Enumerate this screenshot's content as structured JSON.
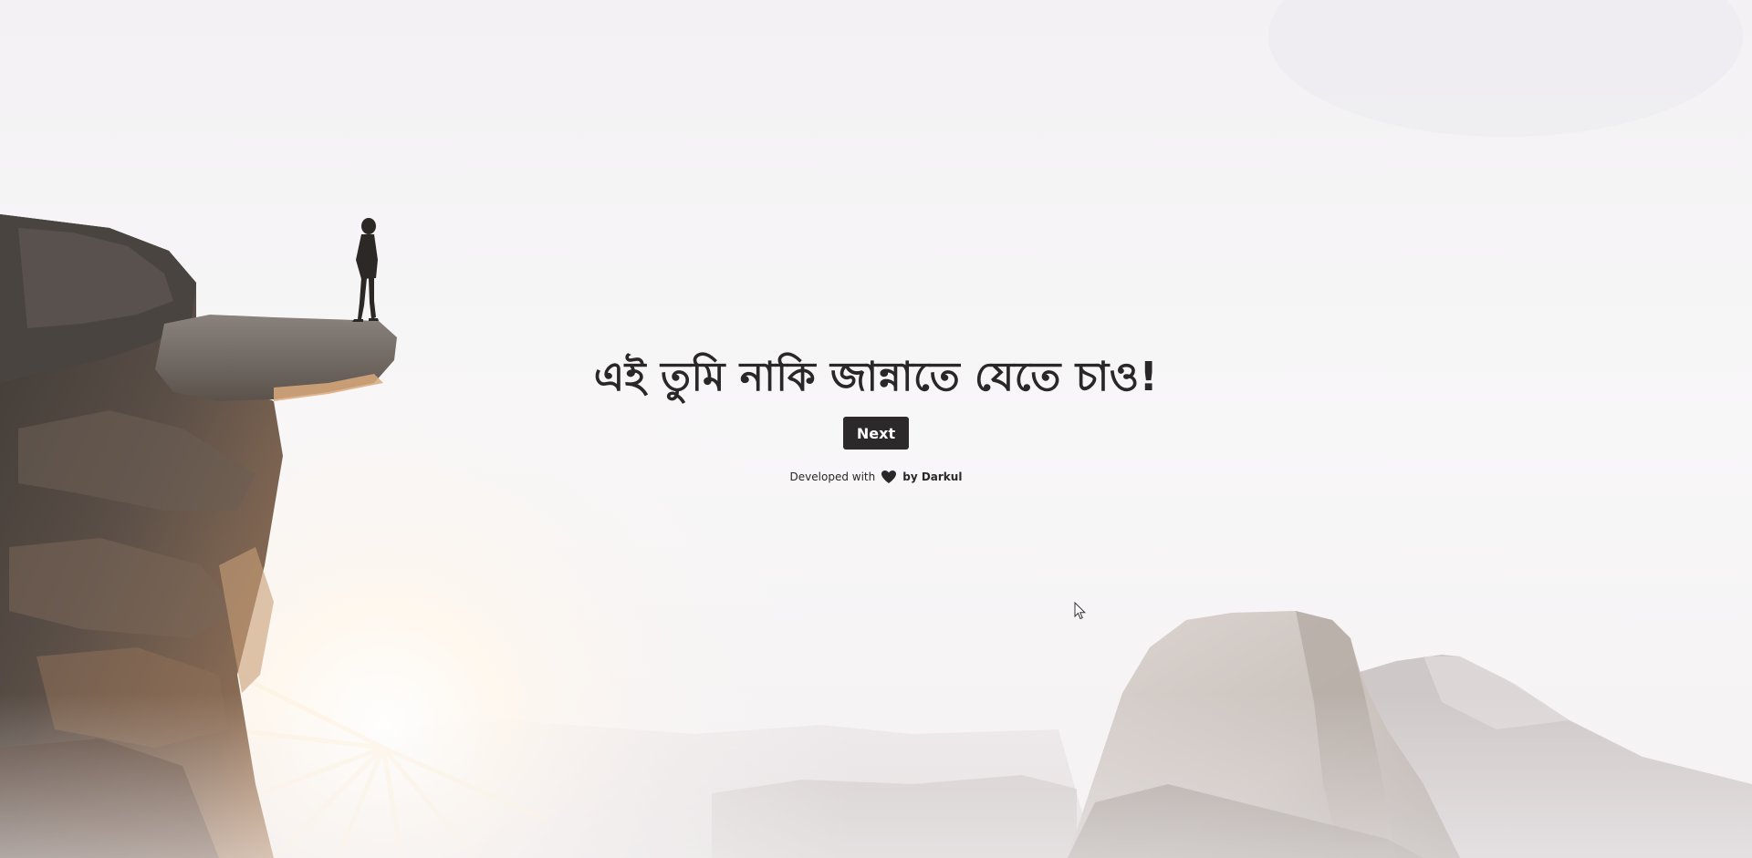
{
  "hero": {
    "headline": "এই তুমি নাকি জান্নাতে যেতে চাও!",
    "next_label": "Next"
  },
  "footer": {
    "prefix": "Developed with",
    "heart_icon": "heart-icon",
    "suffix": "by Darkul"
  },
  "colors": {
    "text": "#2a2728",
    "button_bg": "#2b2929",
    "button_text": "#ffffff",
    "sky": "#f6f4f6"
  },
  "background": "photo: silhouetted person standing on a cliff overlook with sunburst and distant granite mountains"
}
